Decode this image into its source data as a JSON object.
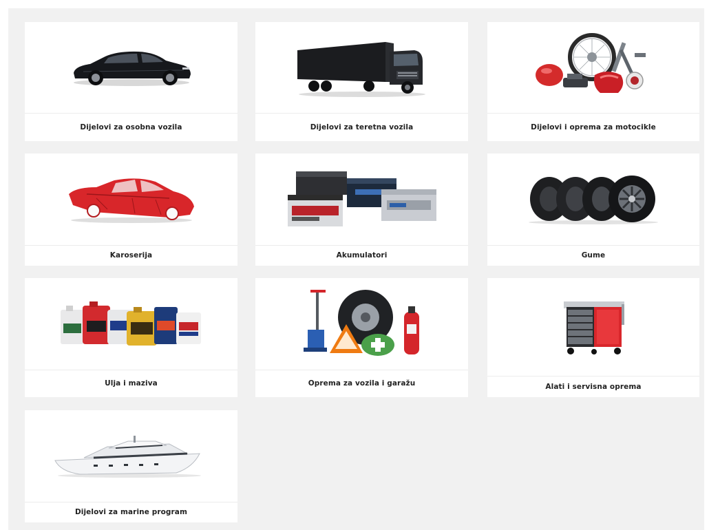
{
  "categories": [
    {
      "label": "Dijelovi za osobna vozila",
      "icon": "car-icon"
    },
    {
      "label": "Dijelovi za teretna vozila",
      "icon": "truck-icon"
    },
    {
      "label": "Dijelovi i oprema za motocikle",
      "icon": "motorcycle-parts-icon"
    },
    {
      "label": "Karoserija",
      "icon": "car-body-icon"
    },
    {
      "label": "Akumulatori",
      "icon": "batteries-icon"
    },
    {
      "label": "Gume",
      "icon": "tires-icon"
    },
    {
      "label": "Ulja i maziva",
      "icon": "oil-bottles-icon"
    },
    {
      "label": "Oprema za vozila i garažu",
      "icon": "vehicle-equipment-icon"
    },
    {
      "label": "Alati i servisna oprema",
      "icon": "tool-cart-icon"
    },
    {
      "label": "Dijelovi za marine program",
      "icon": "yacht-icon"
    }
  ],
  "colors": {
    "background": "#f1f1f1",
    "card": "#ffffff",
    "label_text": "#222222",
    "accent_red": "#d42b2b"
  }
}
